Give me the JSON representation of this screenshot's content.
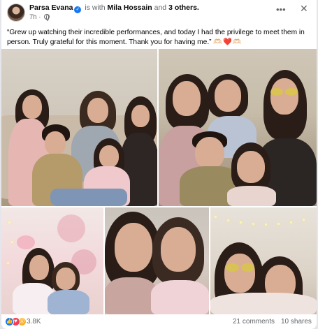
{
  "post": {
    "author": "Parsa Evana",
    "is_with_prefix": "is with",
    "tagged_person": "Mila Hossain",
    "and_word": "and",
    "others": "3 others.",
    "time": "7h",
    "time_sep": "·",
    "caption": "“Grew up watching their incredible performances, and today I had the privilege to meet them in person. Truly grateful for this moment. Thank you for having me.”",
    "caption_emoji": "🫶🏻❤️🫶🏻"
  },
  "stats": {
    "reaction_count": "3.8K",
    "comments": "21 comments",
    "shares": "10 shares"
  },
  "icons": {
    "more": "•••",
    "close": "✕",
    "verified": "✓",
    "like": "👍",
    "love": "♥",
    "wow": "😮"
  },
  "colors": {
    "facebook_blue": "#1877f2",
    "love_red": "#f33e58",
    "wow_yellow": "#f7b125",
    "muted_text": "#65676b"
  }
}
